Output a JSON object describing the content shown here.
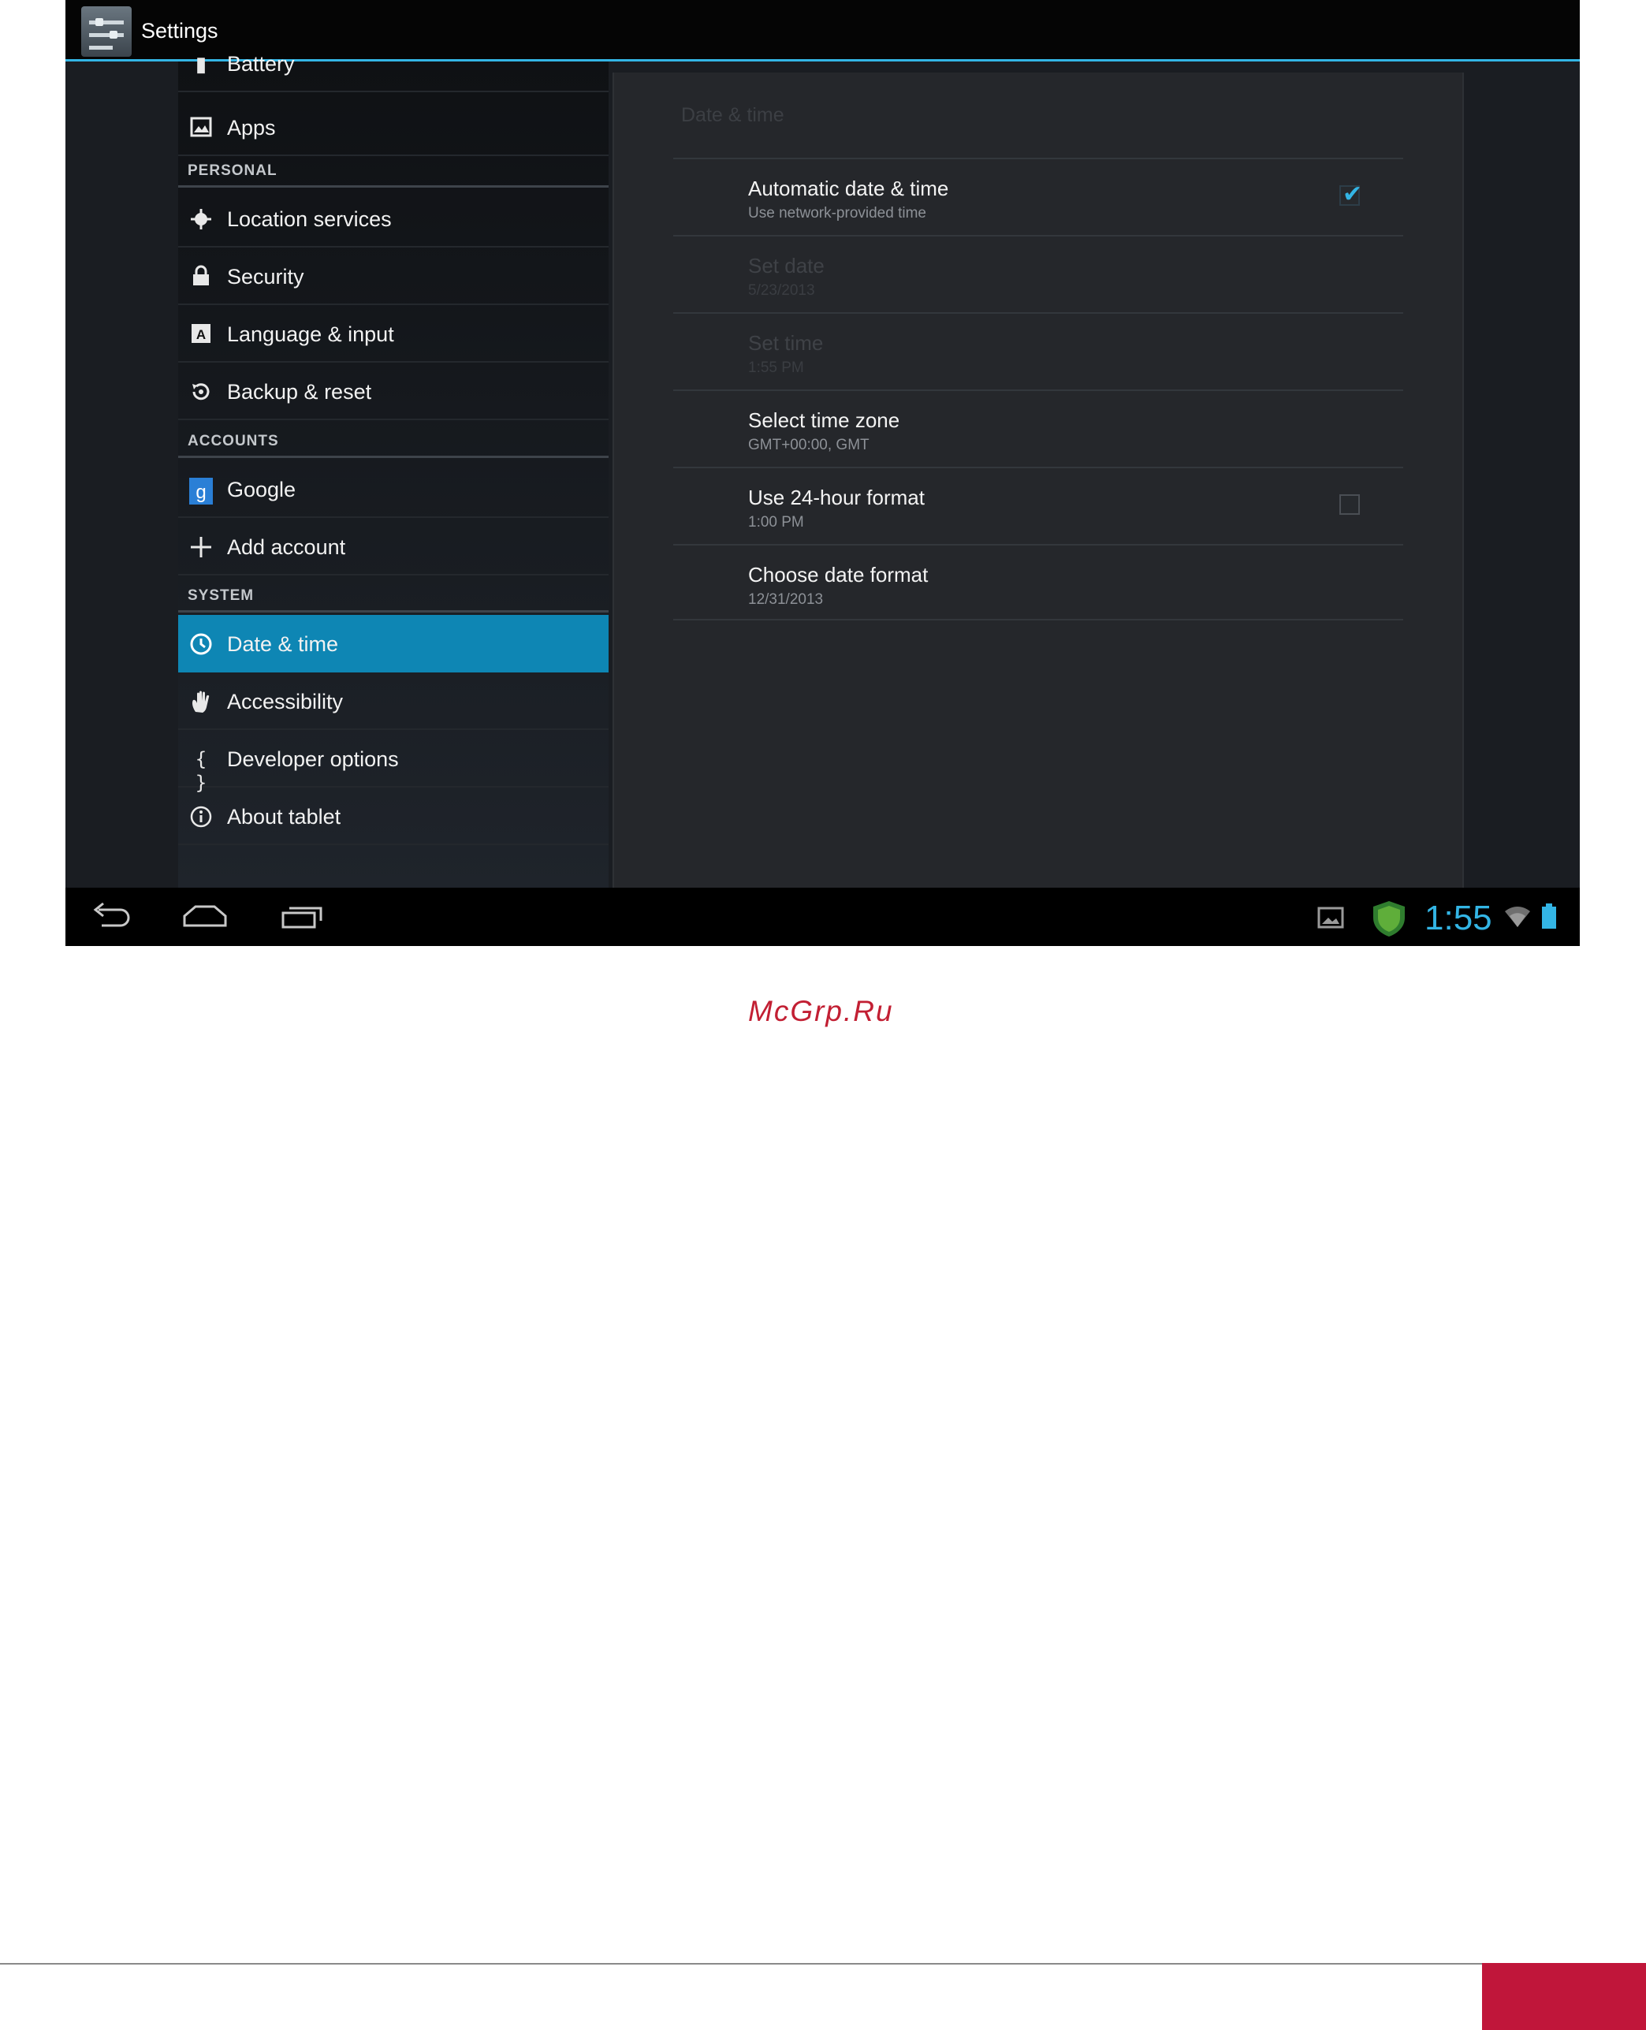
{
  "action_bar": {
    "title": "Settings"
  },
  "sidebar": {
    "partial_item": "Battery",
    "items": [
      {
        "key": "apps",
        "label": "Apps",
        "icon": "apps-icon"
      },
      {
        "key": "location",
        "label": "Location services",
        "icon": "location-icon"
      },
      {
        "key": "security",
        "label": "Security",
        "icon": "lock-icon"
      },
      {
        "key": "language",
        "label": "Language & input",
        "icon": "keyboard-icon"
      },
      {
        "key": "backup",
        "label": "Backup & reset",
        "icon": "backup-icon"
      },
      {
        "key": "google",
        "label": "Google",
        "icon": "google-icon"
      },
      {
        "key": "add_account",
        "label": "Add account",
        "icon": "plus-icon"
      },
      {
        "key": "date_time",
        "label": "Date & time",
        "icon": "clock-icon",
        "selected": true
      },
      {
        "key": "accessibility",
        "label": "Accessibility",
        "icon": "hand-icon"
      },
      {
        "key": "developer",
        "label": "Developer options",
        "icon": "braces-icon"
      },
      {
        "key": "about",
        "label": "About tablet",
        "icon": "info-icon"
      }
    ],
    "sections": {
      "personal": "PERSONAL",
      "accounts": "ACCOUNTS",
      "system": "SYSTEM"
    }
  },
  "detail": {
    "title": "Date & time",
    "prefs": [
      {
        "title": "Automatic date & time",
        "summary": "Use network-provided time",
        "checkbox": true,
        "checked": true,
        "enabled": true
      },
      {
        "title": "Set date",
        "summary": "5/23/2013",
        "enabled": false
      },
      {
        "title": "Set time",
        "summary": "1:55 PM",
        "enabled": false
      },
      {
        "title": "Select time zone",
        "summary": "GMT+00:00, GMT",
        "enabled": true
      },
      {
        "title": "Use 24-hour format",
        "summary": "1:00 PM",
        "checkbox": true,
        "checked": false,
        "enabled": true
      },
      {
        "title": "Choose date format",
        "summary": "12/31/2013",
        "enabled": true
      }
    ]
  },
  "status_bar": {
    "clock": "1:55",
    "accent": "#33b5e5"
  },
  "page": {
    "watermark": "McGrp.Ru",
    "watermark_color": "#c21f33"
  }
}
